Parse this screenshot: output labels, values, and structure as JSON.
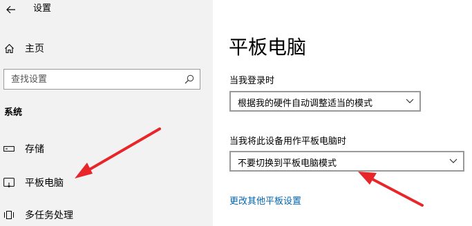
{
  "window": {
    "title": "设置"
  },
  "sidebar": {
    "home_label": "主页",
    "search": {
      "placeholder": "查找设置",
      "value": ""
    },
    "section_title": "系统",
    "items": [
      {
        "label": "存储",
        "icon": "storage-icon"
      },
      {
        "label": "平板电脑",
        "icon": "tablet-icon"
      },
      {
        "label": "多任务处理",
        "icon": "multitasking-icon"
      }
    ]
  },
  "main": {
    "title": "平板电脑",
    "signin_label": "当我登录时",
    "signin_value": "根据我的硬件自动调整适当的模式",
    "tablet_use_label": "当我将此设备用作平板电脑时",
    "tablet_use_value": "不要切换到平板电脑模式",
    "more_link": "更改其他平板设置"
  },
  "colors": {
    "sidebar_bg": "#f2f2f2",
    "link": "#0066b4",
    "annotation_arrow": "#e8262a"
  }
}
